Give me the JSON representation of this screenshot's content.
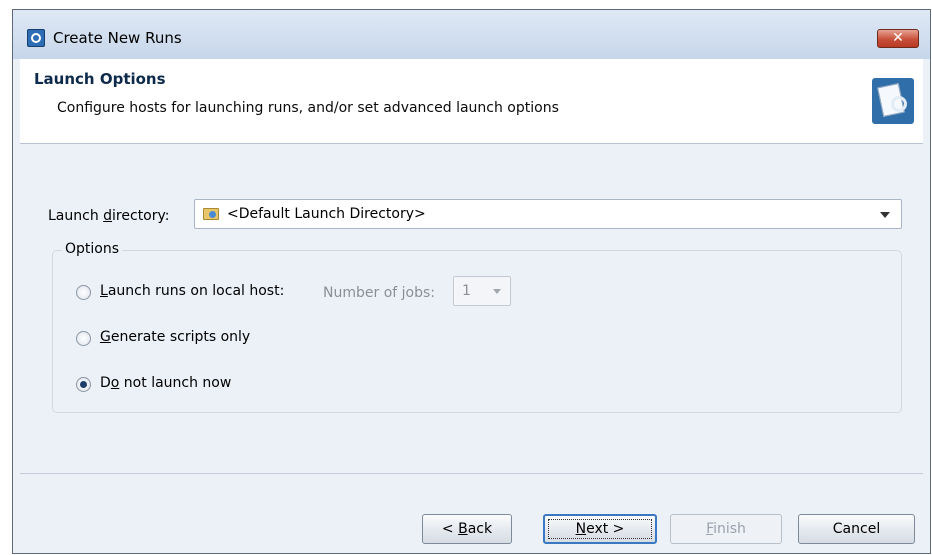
{
  "window": {
    "title": "Create New Runs",
    "close_label": "✕"
  },
  "header": {
    "title": "Launch Options",
    "subtitle": "Configure hosts for launching runs, and/or set advanced launch options"
  },
  "launch_directory": {
    "label_pre": "Launch ",
    "label_u": "d",
    "label_post": "irectory:",
    "value": "<Default Launch Directory>"
  },
  "options": {
    "legend": "Options",
    "local_host": {
      "label_u": "L",
      "label_post": "aunch runs on local host:",
      "checked": false
    },
    "jobs": {
      "label_pre": "Number of ",
      "label_u": "j",
      "label_post": "obs:",
      "value": "1",
      "enabled": false
    },
    "scripts_only": {
      "label_u": "G",
      "label_post": "enerate scripts only",
      "checked": false
    },
    "no_launch": {
      "label_pre": "D",
      "label_u": "o",
      "label_post": " not launch now",
      "checked": true
    }
  },
  "buttons": {
    "back_pre": "< ",
    "back_u": "B",
    "back_post": "ack",
    "next_u": "N",
    "next_post": "ext >",
    "finish_u": "F",
    "finish_post": "inish",
    "cancel": "Cancel"
  },
  "colors": {
    "accent": "#3a78c4",
    "window_bg": "#ecf1f8",
    "close_button": "#c7503a"
  },
  "icons": {
    "app": "app-icon",
    "wizard": "wizard-banner-icon",
    "folder": "folder-icon",
    "close": "close-icon"
  }
}
